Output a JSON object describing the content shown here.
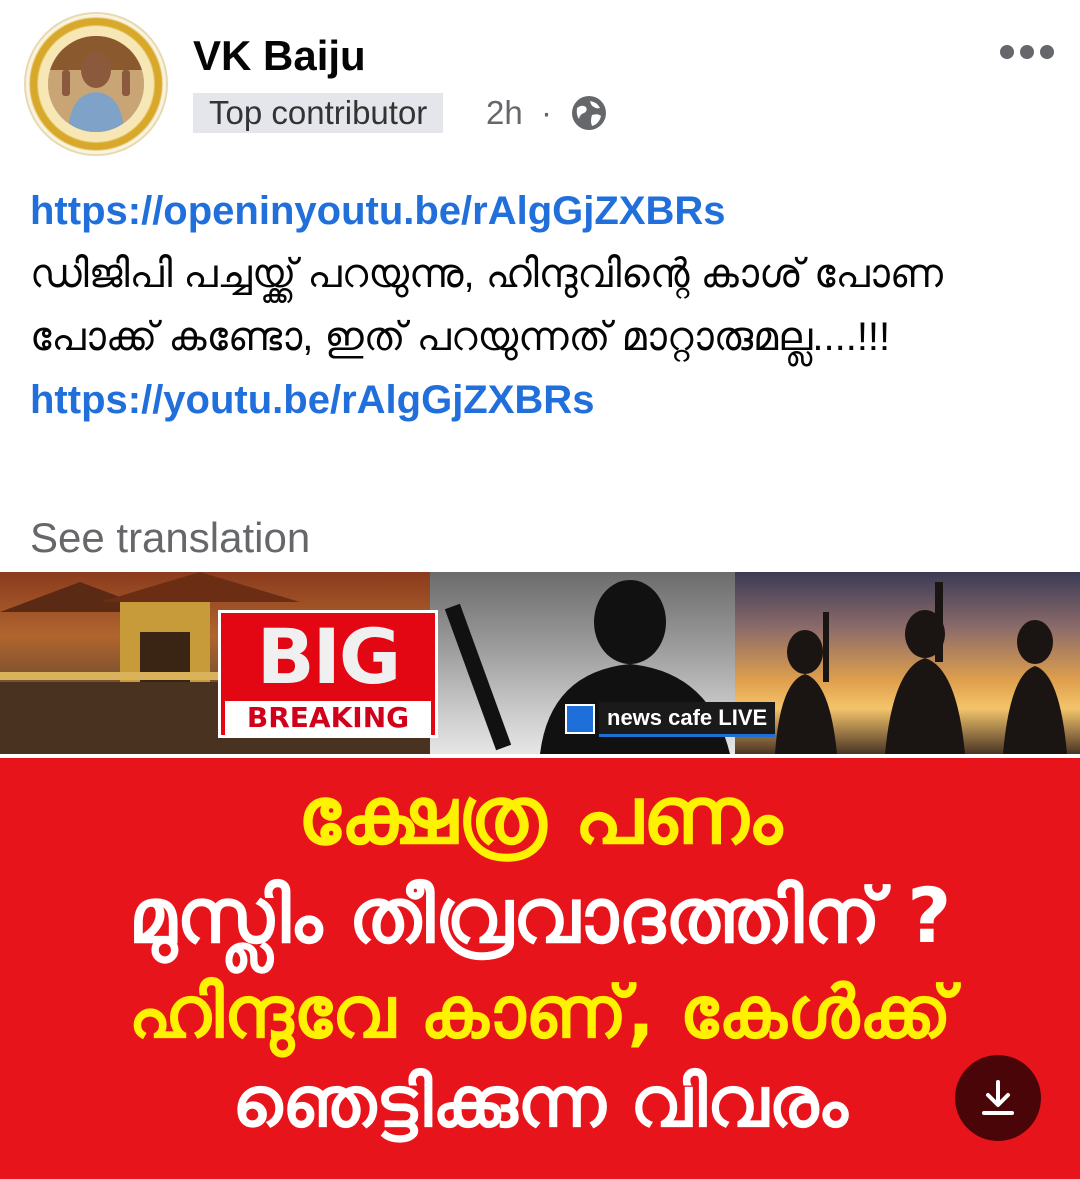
{
  "post": {
    "author": "VK Baiju",
    "badge": "Top contributor",
    "time": "2h",
    "separator": "·",
    "link1": "https://openinyoutu.be/rAlgGjZXBRs",
    "body": "ഡിജിപി പച്ചയ്ക്ക് പറയുന്നു, ഹിന്ദുവിന്റെ കാശ് പോണ പോക്ക് കണ്ടോ, ഇത് പറയുന്നത് മാറ്റാരുമല്ല....!!!",
    "link2": "https://youtu.be/rAlgGjZXBRs",
    "see_translation": "See translation"
  },
  "thumbnail": {
    "big": "BIG",
    "breaking": "BREAKING",
    "channel": "news cafe LIVE",
    "headline_1": "ക്ഷേത്ര പണം",
    "headline_2": "മുസ്ലിം തീവ്രവാദത്തിന് ?",
    "headline_3": "ഹിന്ദുവേ കാണ്, കേൾക്ക്",
    "headline_4": "ഞെട്ടിക്കുന്ന വിവരം"
  },
  "icons": {
    "globe": "globe-icon",
    "more": "more-icon",
    "download": "download-icon"
  },
  "colors": {
    "link": "#216fdb",
    "badge_bg": "#e4e6eb",
    "thumb_red": "#e8141b",
    "headline_yellow": "#fff200"
  }
}
